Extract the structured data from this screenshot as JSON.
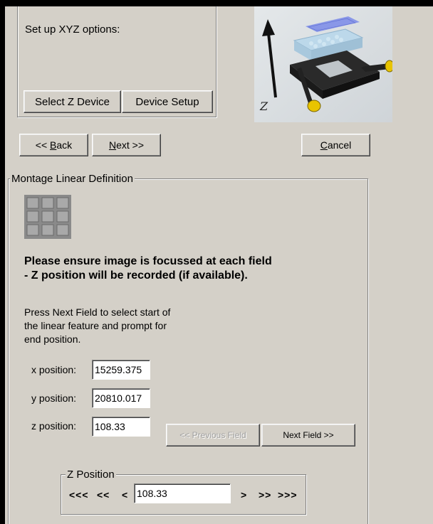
{
  "xyz": {
    "title": "Set up XYZ options:",
    "select_z": "Select Z Device",
    "device_setup": "Device Setup",
    "stage_axis_label": "Z"
  },
  "nav": {
    "back_prefix": "<< ",
    "back_key": "B",
    "back_rest": "ack",
    "next_key": "N",
    "next_rest": "ext >>",
    "cancel_key": "C",
    "cancel_rest": "ancel"
  },
  "montage": {
    "title": "Montage Linear Definition",
    "warning_line1": "Please ensure image is focussed at each field",
    "warning_line2": "- Z position will be recorded (if available).",
    "instructions": [
      "Press Next Field to select start of",
      "the linear feature and prompt for",
      "end position."
    ],
    "x_label": "x position:",
    "x_value": "15259.375",
    "y_label": "y position:",
    "y_value": "20810.017",
    "z_label": "z position:",
    "z_value": "108.33",
    "prev_field": "<< Previous Field",
    "next_field": "Next Field >>"
  },
  "zpos": {
    "title": "Z Position",
    "btn_down3": "<<<",
    "btn_down2": "<<",
    "btn_down1": "<",
    "value": "108.33",
    "btn_up1": ">",
    "btn_up2": ">>",
    "btn_up3": ">>>"
  }
}
